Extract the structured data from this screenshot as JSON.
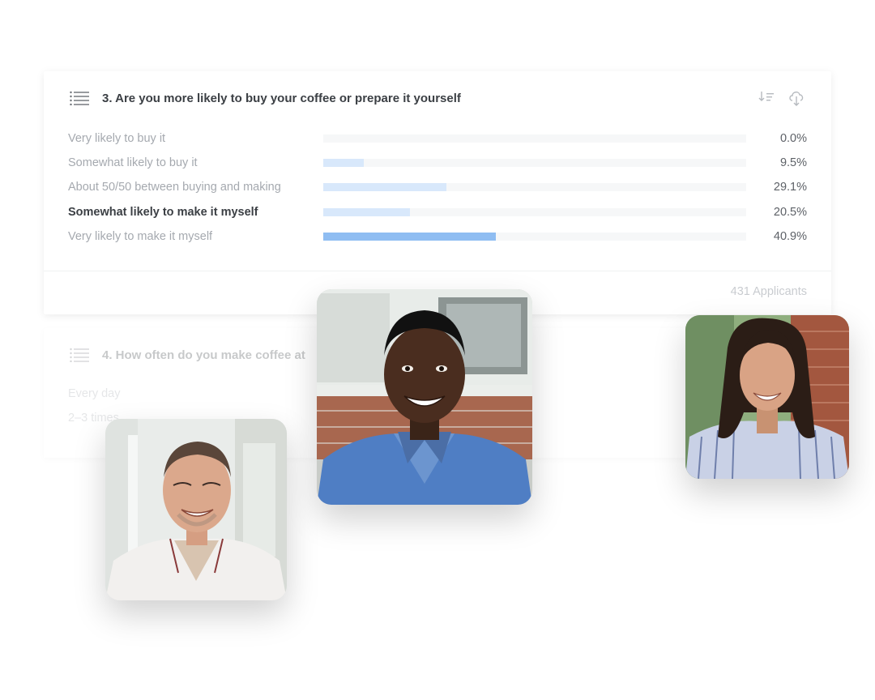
{
  "question3": {
    "title": "3. Are you more likely to buy your coffee or prepare it yourself",
    "answers": [
      {
        "label": "Very likely to buy it",
        "percent": "0.0%",
        "value": 0.0
      },
      {
        "label": "Somewhat likely to buy it",
        "percent": "9.5%",
        "value": 9.5
      },
      {
        "label": "About 50/50 between buying and making",
        "percent": "29.1%",
        "value": 29.1
      },
      {
        "label": "Somewhat likely to make it myself",
        "percent": "20.5%",
        "value": 20.5
      },
      {
        "label": "Very likely to make it myself",
        "percent": "40.9%",
        "value": 40.9
      }
    ],
    "footer": "431 Applicants",
    "icons": {
      "list": "list-icon",
      "sort": "sort-icon",
      "download": "cloud-download-icon"
    }
  },
  "question4": {
    "title": "4. How often do you make coffee at",
    "answers": [
      {
        "label": "Every day"
      },
      {
        "label": "2–3 times"
      }
    ]
  },
  "colors": {
    "bar_track": "#f6f7f8",
    "bar_fill": "#d8e8fb",
    "bar_fill_max": "#8fbdf2",
    "title_text": "#3b3f44",
    "muted_text": "#a5a9af"
  }
}
